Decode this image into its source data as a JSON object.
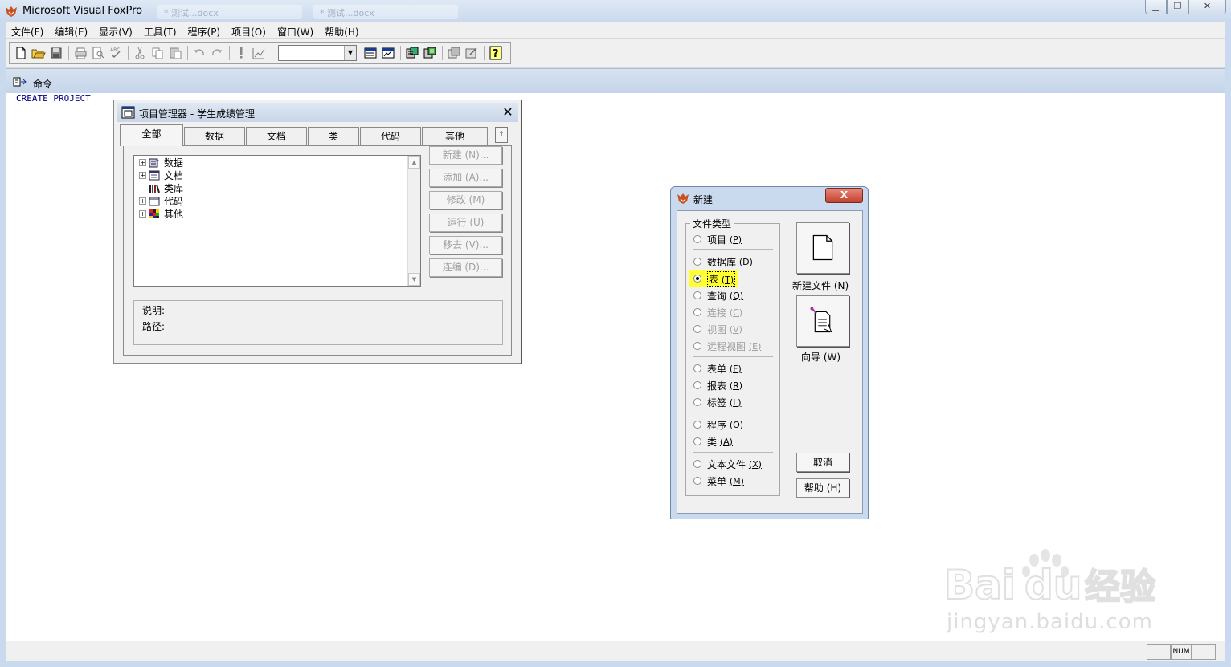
{
  "window": {
    "title": "Microsoft Visual FoxPro",
    "ghost_tab_1": "* 测试...docx",
    "ghost_tab_2": "* 测试...docx"
  },
  "menu": [
    "文件(F)",
    "编辑(E)",
    "显示(V)",
    "工具(T)",
    "程序(P)",
    "项目(O)",
    "窗口(W)",
    "帮助(H)"
  ],
  "toolbar": {
    "icons": [
      "new-file-icon",
      "open-icon",
      "save-icon",
      "print-icon",
      "print-preview-icon",
      "spelling-icon",
      "cut-icon",
      "copy-icon",
      "paste-icon",
      "undo-icon",
      "redo-icon",
      "run-icon",
      "modify-form-icon",
      "command-window-icon",
      "view-window-icon",
      "database-designer-icon",
      "report-designer-icon",
      "form-builder-icon",
      "auto-form-icon",
      "help-icon"
    ],
    "combo_value": ""
  },
  "command_window": {
    "title": "命令",
    "lines": [
      "CREATE PROJECT"
    ]
  },
  "project_manager": {
    "title": "项目管理器 - 学生成绩管理",
    "tabs": [
      "全部",
      "数据",
      "文档",
      "类",
      "代码",
      "其他"
    ],
    "tab_scroll": "↑",
    "tree": [
      {
        "label": "数据",
        "expandable": true,
        "icon": "data-icon"
      },
      {
        "label": "文档",
        "expandable": true,
        "icon": "documents-icon"
      },
      {
        "label": "类库",
        "expandable": false,
        "icon": "class-library-icon"
      },
      {
        "label": "代码",
        "expandable": true,
        "icon": "code-icon"
      },
      {
        "label": "其他",
        "expandable": true,
        "icon": "other-icon"
      }
    ],
    "buttons": [
      "新建 (N)...",
      "添加 (A)...",
      "修改 (M)",
      "运行 (U)",
      "移去 (V)...",
      "连编 (D)..."
    ],
    "description_label": "说明:",
    "path_label": "路径:"
  },
  "new_dialog": {
    "title": "新建",
    "close": "X",
    "group_label": "文件类型",
    "options": [
      {
        "label": "项目",
        "key": "(P)",
        "enabled": true,
        "checked": false
      },
      {
        "label": "数据库",
        "key": "(D)",
        "enabled": true,
        "checked": false
      },
      {
        "label": "表",
        "key": "(T)",
        "enabled": true,
        "checked": true
      },
      {
        "label": "查询",
        "key": "(Q)",
        "enabled": true,
        "checked": false
      },
      {
        "label": "连接",
        "key": "(C)",
        "enabled": false,
        "checked": false
      },
      {
        "label": "视图",
        "key": "(V)",
        "enabled": false,
        "checked": false
      },
      {
        "label": "远程视图",
        "key": "(E)",
        "enabled": false,
        "checked": false
      },
      {
        "label": "表单",
        "key": "(F)",
        "enabled": true,
        "checked": false
      },
      {
        "label": "报表",
        "key": "(R)",
        "enabled": true,
        "checked": false
      },
      {
        "label": "标签",
        "key": "(L)",
        "enabled": true,
        "checked": false
      },
      {
        "label": "程序",
        "key": "(O)",
        "enabled": true,
        "checked": false
      },
      {
        "label": "类",
        "key": "(A)",
        "enabled": true,
        "checked": false
      },
      {
        "label": "文本文件",
        "key": "(X)",
        "enabled": true,
        "checked": false
      },
      {
        "label": "菜单",
        "key": "(M)",
        "enabled": true,
        "checked": false
      }
    ],
    "new_file_label": "新建文件 (N)",
    "wizard_label": "向导 (W)",
    "cancel_label": "取消",
    "help_label": "帮助 (H)",
    "highlight_color": "#ffff33"
  },
  "status_bar": {
    "num": "NUM"
  },
  "watermark": {
    "brand": "Bai du 经验",
    "url": "jingyan.baidu.com"
  },
  "colors": {
    "frame": "#c9d9ee",
    "command_text": "#00008b",
    "dialog_close": "#c2412f"
  }
}
